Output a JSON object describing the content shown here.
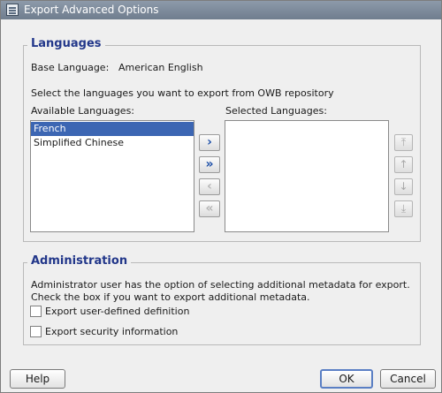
{
  "window": {
    "title": "Export Advanced Options"
  },
  "languages": {
    "legend": "Languages",
    "base_language_label": "Base Language:",
    "base_language_value": "American English",
    "instructions": "Select the languages you want to export from OWB repository",
    "available_label": "Available Languages:",
    "selected_label": "Selected Languages:",
    "available_items": [
      "French",
      "Simplified Chinese"
    ],
    "selected_items": []
  },
  "administration": {
    "legend": "Administration",
    "description_line1": "Administrator user has the option of selecting additional metadata for export.",
    "description_line2": "Check the box if you want to export additional metadata.",
    "export_user_defined": {
      "label": "Export user-defined definition",
      "checked": false
    },
    "export_security": {
      "label": "Export security information",
      "checked": false
    }
  },
  "buttons": {
    "help": "Help",
    "ok": "OK",
    "cancel": "Cancel"
  },
  "colors": {
    "legend": "#22378a",
    "selection": "#3c66b3",
    "shuttle_arrow": "#1d4fa8"
  }
}
